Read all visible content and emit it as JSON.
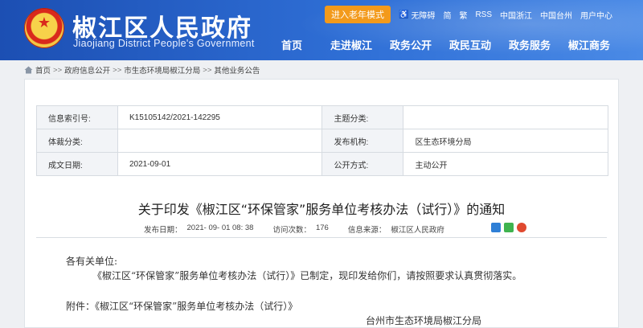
{
  "header": {
    "title": "椒江区人民政府",
    "subtitle": "Jiaojiang District People's Government",
    "elder_mode": "进入老年模式",
    "accessibility": "无障碍",
    "simplified": "简",
    "traditional": "繁",
    "rss": "RSS",
    "link_zhejiang": "中国浙江",
    "link_taizhou": "中国台州",
    "user_center": "用户中心",
    "nav": [
      "首页",
      "走进椒江",
      "政务公开",
      "政民互动",
      "政务服务",
      "椒江商务"
    ]
  },
  "breadcrumb": {
    "items": [
      "首页",
      "政府信息公开",
      "市生态环境局椒江分局",
      "其他业务公告"
    ],
    "separator": ">>"
  },
  "meta": {
    "rows": [
      [
        {
          "label": "信息索引号:",
          "value": "K15105142/2021-142295"
        },
        {
          "label": "主题分类:",
          "value": ""
        }
      ],
      [
        {
          "label": "体裁分类:",
          "value": ""
        },
        {
          "label": "发布机构:",
          "value": "区生态环境分局"
        }
      ],
      [
        {
          "label": "成文日期:",
          "value": "2021-09-01"
        },
        {
          "label": "公开方式:",
          "value": "主动公开"
        }
      ]
    ]
  },
  "document": {
    "title": "关于印发《椒江区“环保管家”服务单位考核办法（试行）》的通知",
    "publish_label": "发布日期：",
    "publish_date": "2021- 09- 01 08: 38",
    "views_label": "访问次数：",
    "views": "176",
    "source_label": "信息来源：",
    "source": "椒江区人民政府",
    "salutation": "各有关单位:",
    "paragraph": "《椒江区“环保管家”服务单位考核办法（试行）》已制定，现印发给你们，请按照要求认真贯彻落实。",
    "attachment": "附件：《椒江区“环保管家”服务单位考核办法（试行）》",
    "signature": "台州市生态环境局椒江分局"
  },
  "colors": {
    "header_blue": "#1c4fb3",
    "elder_orange": "#f39a1b",
    "emblem_red": "#d9291c",
    "emblem_gold": "#f7d24a"
  }
}
